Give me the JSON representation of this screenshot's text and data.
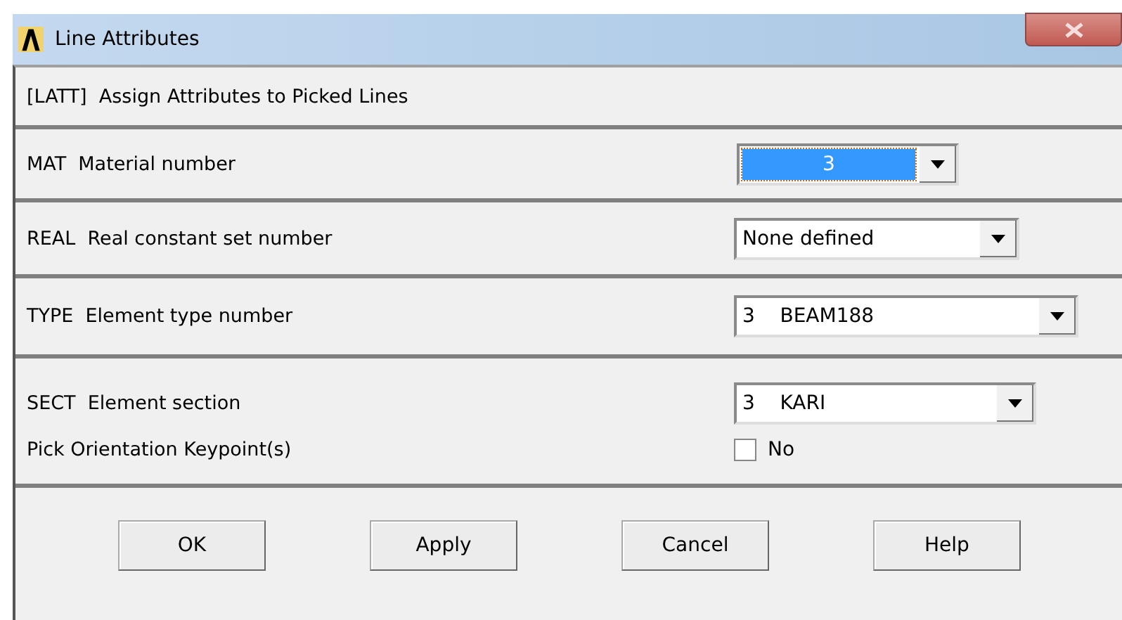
{
  "window": {
    "title": "Line Attributes"
  },
  "header": "[LATT]  Assign Attributes to Picked Lines",
  "sections": [
    {
      "fields": [
        {
          "kind": "dropdown",
          "label": "MAT  Material number",
          "value": "3",
          "focused": true
        }
      ]
    },
    {
      "fields": [
        {
          "kind": "dropdown",
          "label": "REAL  Real constant set number",
          "value": "None defined",
          "focused": false
        }
      ]
    },
    {
      "fields": [
        {
          "kind": "dropdown",
          "label": "TYPE  Element type number",
          "value": "3    BEAM188",
          "focused": false
        }
      ]
    },
    {
      "fields": [
        {
          "kind": "dropdown",
          "label": "SECT  Element section",
          "value": "3    KARI",
          "focused": false
        },
        {
          "kind": "checkbox",
          "label": "Pick Orientation Keypoint(s)",
          "value": "No",
          "checked": false
        }
      ]
    }
  ],
  "buttons": [
    "OK",
    "Apply",
    "Cancel",
    "Help"
  ]
}
